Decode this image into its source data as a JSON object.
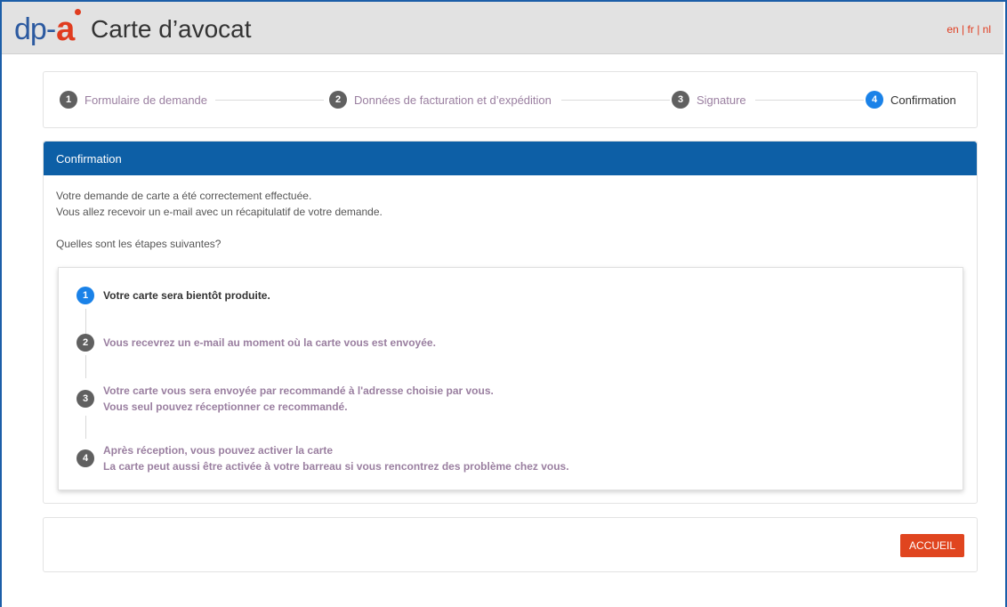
{
  "header": {
    "logo": {
      "left": "dp",
      "right": "a"
    },
    "title": "Carte d’avocat",
    "languages": [
      "en",
      "fr",
      "nl"
    ],
    "lang_separator": "|",
    "accent_color": "#e03c1f",
    "brand_color": "#2c5aa0"
  },
  "stepper": {
    "steps": [
      {
        "number": "1",
        "label": "Formulaire de demande",
        "active": false
      },
      {
        "number": "2",
        "label": "Données de facturation et d’expédition",
        "active": false
      },
      {
        "number": "3",
        "label": "Signature",
        "active": false
      },
      {
        "number": "4",
        "label": "Confirmation",
        "active": true
      }
    ],
    "active_color": "#1a82e8"
  },
  "confirmation": {
    "panel_title": "Confirmation",
    "panel_color": "#0d5fa6",
    "line1": "Votre demande de carte a été correctement effectuée.",
    "line2": "Vous allez recevoir un e-mail avec un récapitulatif de votre demande.",
    "question": "Quelles sont les étapes suivantes?",
    "next_steps": [
      {
        "number": "1",
        "lines": [
          "Votre carte sera bientôt produite."
        ],
        "active": true
      },
      {
        "number": "2",
        "lines": [
          "Vous recevrez un e-mail au moment où la carte vous est envoyée."
        ],
        "active": false
      },
      {
        "number": "3",
        "lines": [
          "Votre carte vous sera envoyée par recommandé à l'adresse choisie par vous.",
          "Vous seul pouvez réceptionner ce recommandé."
        ],
        "active": false
      },
      {
        "number": "4",
        "lines": [
          "Après réception, vous pouvez activer la carte",
          "La carte peut aussi être activée à votre barreau si vous rencontrez des problème chez vous."
        ],
        "active": false
      }
    ]
  },
  "footer": {
    "home_button": "ACCUEIL",
    "home_button_color": "#e0451f"
  }
}
